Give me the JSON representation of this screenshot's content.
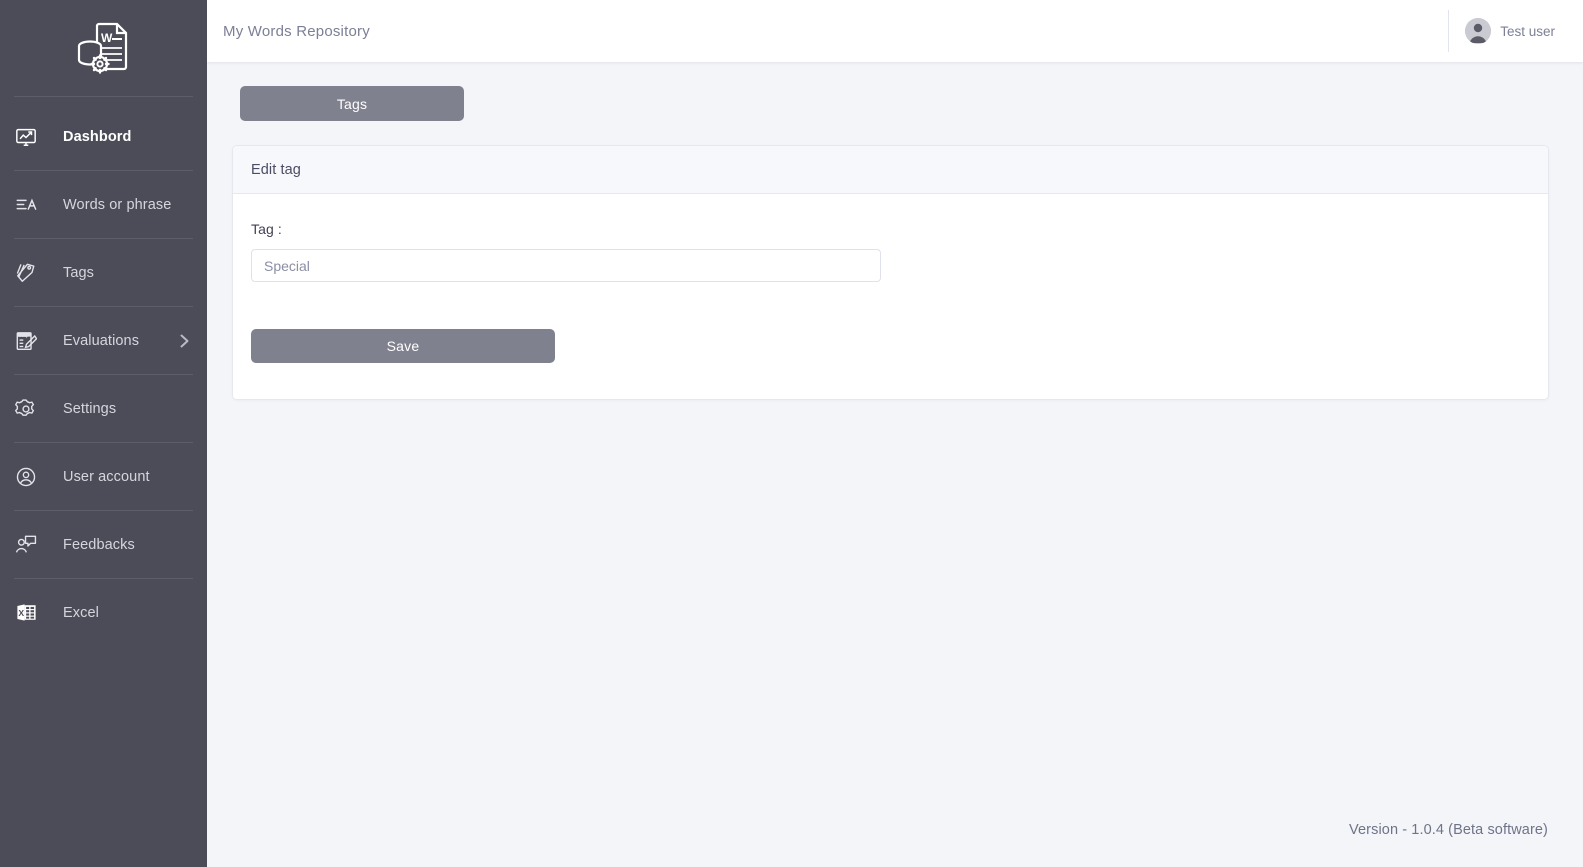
{
  "app": {
    "logo_icon": "database-gear-word-document-icon",
    "sidebar_bg": "#4c4c58",
    "accent": "#80818f",
    "page_bg": "#f4f5f9"
  },
  "sidebar": {
    "items": [
      {
        "label": "Dashbord",
        "icon": "monitor-chart-icon",
        "active": true,
        "chevron": false
      },
      {
        "label": "Words or phrase",
        "icon": "text-lines-a-icon",
        "active": false,
        "chevron": false
      },
      {
        "label": "Tags",
        "icon": "tags-icon",
        "active": false,
        "chevron": false
      },
      {
        "label": "Evaluations",
        "icon": "exam-clipboard-icon",
        "active": false,
        "chevron": true
      },
      {
        "label": "Settings",
        "icon": "gear-icon",
        "active": false,
        "chevron": false
      },
      {
        "label": "User account",
        "icon": "user-circle-icon",
        "active": false,
        "chevron": false
      },
      {
        "label": "Feedbacks",
        "icon": "user-comment-icon",
        "active": false,
        "chevron": false
      },
      {
        "label": "Excel",
        "icon": "excel-file-icon",
        "active": false,
        "chevron": false
      }
    ]
  },
  "header": {
    "breadcrumb": "My Words Repository",
    "user_name": "Test user",
    "avatar_icon": "user-avatar-icon"
  },
  "main": {
    "tab_label": "Tags",
    "card_title": "Edit tag",
    "field_label": "Tag :",
    "tag_value": "Special",
    "tag_placeholder": "Special",
    "save_label": "Save"
  },
  "footer": {
    "version": "Version - 1.0.4 (Beta software)"
  }
}
